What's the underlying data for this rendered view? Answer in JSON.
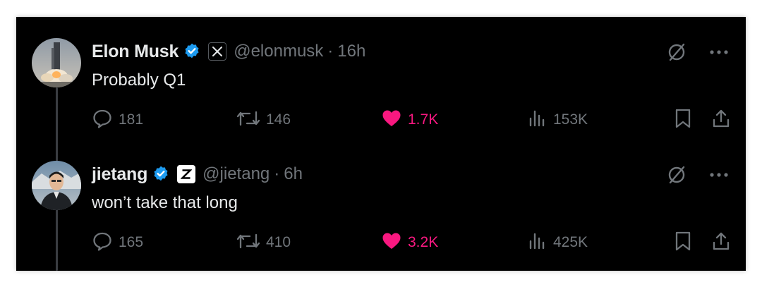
{
  "tweets": [
    {
      "name": "Elon Musk",
      "handle": "@elonmusk",
      "dot": "·",
      "time": "16h",
      "org_badge": "x-logo-badge",
      "text": "Probably Q1",
      "replies": "181",
      "retweets": "146",
      "likes": "1.7K",
      "views": "153K"
    },
    {
      "name": "jietang",
      "handle": "@jietang",
      "dot": "·",
      "time": "6h",
      "org_badge": "z-logo-badge",
      "text": "won’t take that long",
      "replies": "165",
      "retweets": "410",
      "likes": "3.2K",
      "views": "425K"
    }
  ],
  "colors": {
    "background": "#000000",
    "text": "#e7e9ea",
    "muted": "#71767b",
    "verified": "#1d9bf0",
    "like": "#f91880"
  }
}
